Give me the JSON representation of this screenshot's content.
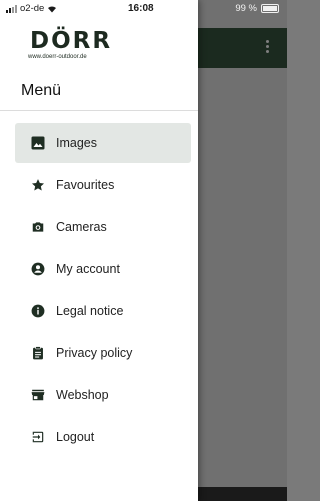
{
  "status_bar": {
    "carrier": "o2-de",
    "time": "16:08",
    "battery": "99 %"
  },
  "brand": {
    "name": "DÖRR",
    "url": "www.doerr-outdoor.de",
    "color": "#1d2a20"
  },
  "drawer": {
    "title": "Menü",
    "items": [
      {
        "label": "Images",
        "icon": "image-icon",
        "active": true
      },
      {
        "label": "Favourites",
        "icon": "star-icon",
        "active": false
      },
      {
        "label": "Cameras",
        "icon": "camera-icon",
        "active": false
      },
      {
        "label": "My account",
        "icon": "account-circle-icon",
        "active": false
      },
      {
        "label": "Legal notice",
        "icon": "info-icon",
        "active": false
      },
      {
        "label": "Privacy policy",
        "icon": "clipboard-icon",
        "active": false
      },
      {
        "label": "Webshop",
        "icon": "store-icon",
        "active": false
      },
      {
        "label": "Logout",
        "icon": "logout-icon",
        "active": false
      }
    ]
  },
  "colors": {
    "active_item_bg": "#e3e7e4",
    "toolbar_bg": "#1b2a1f",
    "scrim": "#707070"
  }
}
